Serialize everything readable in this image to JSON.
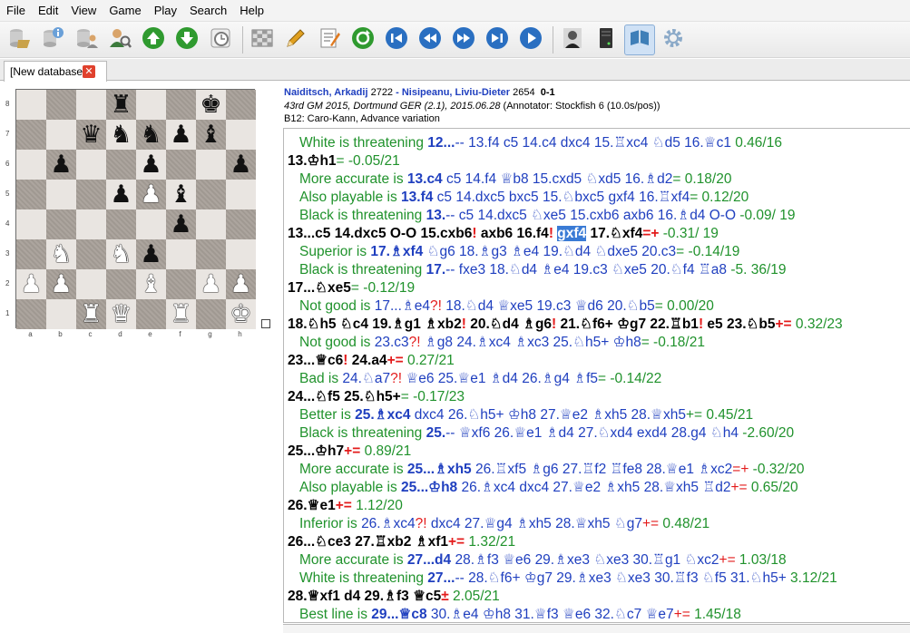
{
  "menu": [
    "File",
    "Edit",
    "View",
    "Game",
    "Play",
    "Search",
    "Help"
  ],
  "toolbar": [
    {
      "icon": "open-database-icon",
      "color": "#c9a24a"
    },
    {
      "icon": "database-info-icon",
      "color": "#6aa0d8"
    },
    {
      "icon": "database-users-icon",
      "color": "#8c8c8c"
    },
    {
      "icon": "player-search-icon",
      "color": "#3c7a3c"
    },
    {
      "icon": "arrow-up-icon",
      "color": "#2f9a2f"
    },
    {
      "icon": "arrow-down-icon",
      "color": "#2f9a2f"
    },
    {
      "icon": "clock-icon",
      "color": "#7a7a7a"
    },
    {
      "icon": "board-icon",
      "color": "#9a9a9a"
    },
    {
      "icon": "pencil-icon",
      "color": "#e0a020"
    },
    {
      "icon": "notes-icon",
      "color": "#e07a20"
    },
    {
      "icon": "refresh-icon",
      "color": "#2f9a2f"
    },
    {
      "icon": "first-move-icon",
      "color": "#2a6fc1"
    },
    {
      "icon": "previous-move-icon",
      "color": "#2a6fc1"
    },
    {
      "icon": "next-move-icon",
      "color": "#2a6fc1"
    },
    {
      "icon": "last-move-icon",
      "color": "#2a6fc1"
    },
    {
      "icon": "play-icon",
      "color": "#2a6fc1"
    },
    {
      "icon": "player-icon",
      "color": "#555555"
    },
    {
      "icon": "engine-icon",
      "color": "#333333"
    },
    {
      "icon": "book-icon",
      "color": "#3f7fb8"
    },
    {
      "icon": "settings-gear-icon",
      "color": "#8aa9c8"
    }
  ],
  "tab": {
    "label": "[New database]",
    "close": "✕"
  },
  "board": {
    "rank_labels": [
      "8",
      "7",
      "6",
      "5",
      "4",
      "3",
      "2",
      "1"
    ],
    "file_labels": [
      "a",
      "b",
      "c",
      "d",
      "e",
      "f",
      "g",
      "h"
    ],
    "squares": [
      [
        "",
        "",
        "",
        "bR",
        "",
        "",
        "bK",
        ""
      ],
      [
        "",
        "",
        "bQ",
        "bN",
        "bN",
        "bP",
        "bB",
        ""
      ],
      [
        "",
        "bP",
        "",
        "",
        "bP",
        "",
        "",
        "bP"
      ],
      [
        "",
        "",
        "",
        "bP",
        "wP",
        "bB",
        "",
        ""
      ],
      [
        "",
        "",
        "",
        "",
        "",
        "bP",
        "",
        ""
      ],
      [
        "",
        "wN",
        "",
        "wN",
        "bP",
        "",
        "",
        ""
      ],
      [
        "wP",
        "wP",
        "",
        "",
        "wB",
        "",
        "wP",
        "wP"
      ],
      [
        "",
        "",
        "wR",
        "wQ",
        "",
        "wR",
        "",
        "wK"
      ]
    ]
  },
  "header": {
    "white_player": "Naiditsch, Arkadij",
    "white_elo": "2722",
    "sep": " - ",
    "black_player": "Nisipeanu, Liviu-Dieter",
    "black_elo": "2654",
    "result": "0-1",
    "event": "43rd GM 2015, Dortmund GER (2.1), 2015.06.28",
    "annotator": "(Annotator: Stockfish 6 (10.0s/pos))",
    "opening": "B12: Caro-Kann, Advance variation"
  },
  "notation": [
    {
      "kind": "var",
      "parts": [
        {
          "t": "White is threatening "
        },
        {
          "t": "12...",
          "c": "blueb"
        },
        {
          "t": "-- 13.f4 c5 14.c4 dxc4 15.♖xc4 ♘d5 16.♕c1",
          "c": "blue"
        },
        {
          "t": " 0.46/16"
        }
      ]
    },
    {
      "kind": "main",
      "parts": [
        {
          "t": "13.♔h1"
        },
        {
          "t": "= -0.05/21",
          "c": "ev"
        }
      ]
    },
    {
      "kind": "var",
      "parts": [
        {
          "t": "More accurate is "
        },
        {
          "t": "13.c4",
          "c": "blueb"
        },
        {
          "t": " c5 14.f4 ♕b8 15.cxd5 ♘xd5 16.♗d2",
          "c": "blue"
        },
        {
          "t": "= 0.18/20"
        }
      ]
    },
    {
      "kind": "var",
      "parts": [
        {
          "t": "Also playable is "
        },
        {
          "t": "13.f4",
          "c": "blueb"
        },
        {
          "t": " c5 14.dxc5 bxc5 15.♘bxc5 gxf4 16.♖xf4",
          "c": "blue"
        },
        {
          "t": "= 0.12/20"
        }
      ]
    },
    {
      "kind": "var",
      "parts": [
        {
          "t": "Black is threatening "
        },
        {
          "t": "13.",
          "c": "blueb"
        },
        {
          "t": "-- c5 14.dxc5 ♘xe5 15.cxb6 axb6 16.♗d4 O-O",
          "c": "blue"
        },
        {
          "t": " -0.09/ 19"
        }
      ]
    },
    {
      "kind": "main",
      "parts": [
        {
          "t": "13...c5 14.dxc5 O-O 15.cxb6"
        },
        {
          "t": "!",
          "c": "red"
        },
        {
          "t": " axb6 16.f4"
        },
        {
          "t": "!",
          "c": "red"
        },
        {
          "t": " "
        },
        {
          "t": "gxf4",
          "c": "sel"
        },
        {
          "t": " 17.♘xf4"
        },
        {
          "t": "=+",
          "c": "red"
        },
        {
          "t": " -0.31/ 19",
          "c": "ev"
        }
      ]
    },
    {
      "kind": "var",
      "parts": [
        {
          "t": "Superior is "
        },
        {
          "t": "17.♗xf4",
          "c": "blueb"
        },
        {
          "t": " ♘g6 18.♗g3 ♗e4 19.♘d4 ♘dxe5 20.c3",
          "c": "blue"
        },
        {
          "t": "= -0.14/19"
        }
      ]
    },
    {
      "kind": "var",
      "parts": [
        {
          "t": "Black is threatening "
        },
        {
          "t": "17.",
          "c": "blueb"
        },
        {
          "t": "-- fxe3 18.♘d4 ♗e4 19.c3 ♘xe5 20.♘f4 ♖a8",
          "c": "blue"
        },
        {
          "t": " -5. 36/19"
        }
      ]
    },
    {
      "kind": "main",
      "parts": [
        {
          "t": "17...♘xe5"
        },
        {
          "t": "= -0.12/19",
          "c": "ev"
        }
      ]
    },
    {
      "kind": "var",
      "parts": [
        {
          "t": "Not good is "
        },
        {
          "t": "17...♗e4",
          "c": "blue"
        },
        {
          "t": "?!",
          "c": "red"
        },
        {
          "t": " 18.♘d4 ♕xe5 19.c3 ♕d6 20.♘b5",
          "c": "blue"
        },
        {
          "t": "= 0.00/20"
        }
      ]
    },
    {
      "kind": "main",
      "parts": [
        {
          "t": "18.♘h5 ♘c4 19.♗g1 ♗xb2"
        },
        {
          "t": "!",
          "c": "red"
        },
        {
          "t": " 20.♘d4 ♗g6"
        },
        {
          "t": "!",
          "c": "red"
        },
        {
          "t": " 21.♘f6+ ♔g7 22.♖b1"
        },
        {
          "t": "!",
          "c": "red"
        },
        {
          "t": " e5 23.♘b5"
        },
        {
          "t": "+=",
          "c": "red"
        },
        {
          "t": " 0.32/23",
          "c": "ev"
        }
      ]
    },
    {
      "kind": "var",
      "parts": [
        {
          "t": "Not good is "
        },
        {
          "t": "23.c3",
          "c": "blue"
        },
        {
          "t": "?!",
          "c": "red"
        },
        {
          "t": " ♗g8 24.♗xc4 ♗xc3 25.♘h5+ ♔h8",
          "c": "blue"
        },
        {
          "t": "= -0.18/21"
        }
      ]
    },
    {
      "kind": "main",
      "parts": [
        {
          "t": "23...♕c6"
        },
        {
          "t": "!",
          "c": "red"
        },
        {
          "t": " 24.a4"
        },
        {
          "t": "+=",
          "c": "red"
        },
        {
          "t": " 0.27/21",
          "c": "ev"
        }
      ]
    },
    {
      "kind": "var",
      "parts": [
        {
          "t": "Bad is "
        },
        {
          "t": "24.♘a7",
          "c": "blue"
        },
        {
          "t": "?!",
          "c": "red"
        },
        {
          "t": " ♕e6 25.♕e1 ♗d4 26.♗g4 ♗f5",
          "c": "blue"
        },
        {
          "t": "= -0.14/22"
        }
      ]
    },
    {
      "kind": "main",
      "parts": [
        {
          "t": "24...♘f5 25.♘h5+"
        },
        {
          "t": "= -0.17/23",
          "c": "ev"
        }
      ]
    },
    {
      "kind": "var",
      "parts": [
        {
          "t": "Better is "
        },
        {
          "t": "25.♗xc4",
          "c": "blueb"
        },
        {
          "t": " dxc4 26.♘h5+ ♔h8 27.♕e2 ♗xh5 28.♕xh5",
          "c": "blue"
        },
        {
          "t": "+= 0.45/21"
        }
      ]
    },
    {
      "kind": "var",
      "parts": [
        {
          "t": "Black is threatening "
        },
        {
          "t": "25.",
          "c": "blueb"
        },
        {
          "t": "-- ♕xf6 26.♕e1 ♗d4 27.♘xd4 exd4 28.g4 ♘h4",
          "c": "blue"
        },
        {
          "t": " -2.60/20"
        }
      ]
    },
    {
      "kind": "main",
      "parts": [
        {
          "t": "25...♔h7"
        },
        {
          "t": "+=",
          "c": "red"
        },
        {
          "t": " 0.89/21",
          "c": "ev"
        }
      ]
    },
    {
      "kind": "var",
      "parts": [
        {
          "t": "More accurate is "
        },
        {
          "t": "25...♗xh5",
          "c": "blueb"
        },
        {
          "t": " 26.♖xf5 ♗g6 27.♖f2 ♖fe8 28.♕e1 ♗xc2",
          "c": "blue"
        },
        {
          "t": "=+",
          "c": "red"
        },
        {
          "t": " -0.32/20"
        }
      ]
    },
    {
      "kind": "var",
      "parts": [
        {
          "t": "Also playable is "
        },
        {
          "t": "25...♔h8",
          "c": "blueb"
        },
        {
          "t": " 26.♗xc4 dxc4 27.♕e2 ♗xh5 28.♕xh5 ♖d2",
          "c": "blue"
        },
        {
          "t": "+=",
          "c": "red"
        },
        {
          "t": " 0.65/20"
        }
      ]
    },
    {
      "kind": "main",
      "parts": [
        {
          "t": "26.♕e1"
        },
        {
          "t": "+=",
          "c": "red"
        },
        {
          "t": " 1.12/20",
          "c": "ev"
        }
      ]
    },
    {
      "kind": "var",
      "parts": [
        {
          "t": "Inferior is "
        },
        {
          "t": "26.♗xc4",
          "c": "blue"
        },
        {
          "t": "?!",
          "c": "red"
        },
        {
          "t": " dxc4 27.♕g4 ♗xh5 28.♕xh5 ♘g7",
          "c": "blue"
        },
        {
          "t": "+=",
          "c": "red"
        },
        {
          "t": " 0.48/21"
        }
      ]
    },
    {
      "kind": "main",
      "parts": [
        {
          "t": "26...♘ce3 27.♖xb2 ♗xf1"
        },
        {
          "t": "+=",
          "c": "red"
        },
        {
          "t": " 1.32/21",
          "c": "ev"
        }
      ]
    },
    {
      "kind": "var",
      "parts": [
        {
          "t": "More accurate is "
        },
        {
          "t": "27...d4",
          "c": "blueb"
        },
        {
          "t": " 28.♗f3 ♕e6 29.♗xe3 ♘xe3 30.♖g1 ♘xc2",
          "c": "blue"
        },
        {
          "t": "+=",
          "c": "red"
        },
        {
          "t": " 1.03/18"
        }
      ]
    },
    {
      "kind": "var",
      "parts": [
        {
          "t": "White is threatening "
        },
        {
          "t": "27...",
          "c": "blueb"
        },
        {
          "t": "-- 28.♘f6+ ♔g7 29.♗xe3 ♘xe3 30.♖f3 ♘f5 31.♘h5+",
          "c": "blue"
        },
        {
          "t": " 3.12/21"
        }
      ]
    },
    {
      "kind": "main",
      "parts": [
        {
          "t": "28.♕xf1 d4 29.♗f3 ♕c5"
        },
        {
          "t": "±",
          "c": "red"
        },
        {
          "t": " 2.05/21",
          "c": "ev"
        }
      ]
    },
    {
      "kind": "var",
      "parts": [
        {
          "t": "Best line is "
        },
        {
          "t": "29...♕c8",
          "c": "blueb"
        },
        {
          "t": " 30.♗e4 ♔h8 31.♕f3 ♕e6 32.♘c7 ♕e7",
          "c": "blue"
        },
        {
          "t": "+=",
          "c": "red"
        },
        {
          "t": " 1.45/18"
        }
      ]
    }
  ],
  "colors": {
    "blue": "#1f3fbf",
    "green": "#20922c",
    "red": "#e31b1b",
    "selection": "#3a7bd5"
  }
}
